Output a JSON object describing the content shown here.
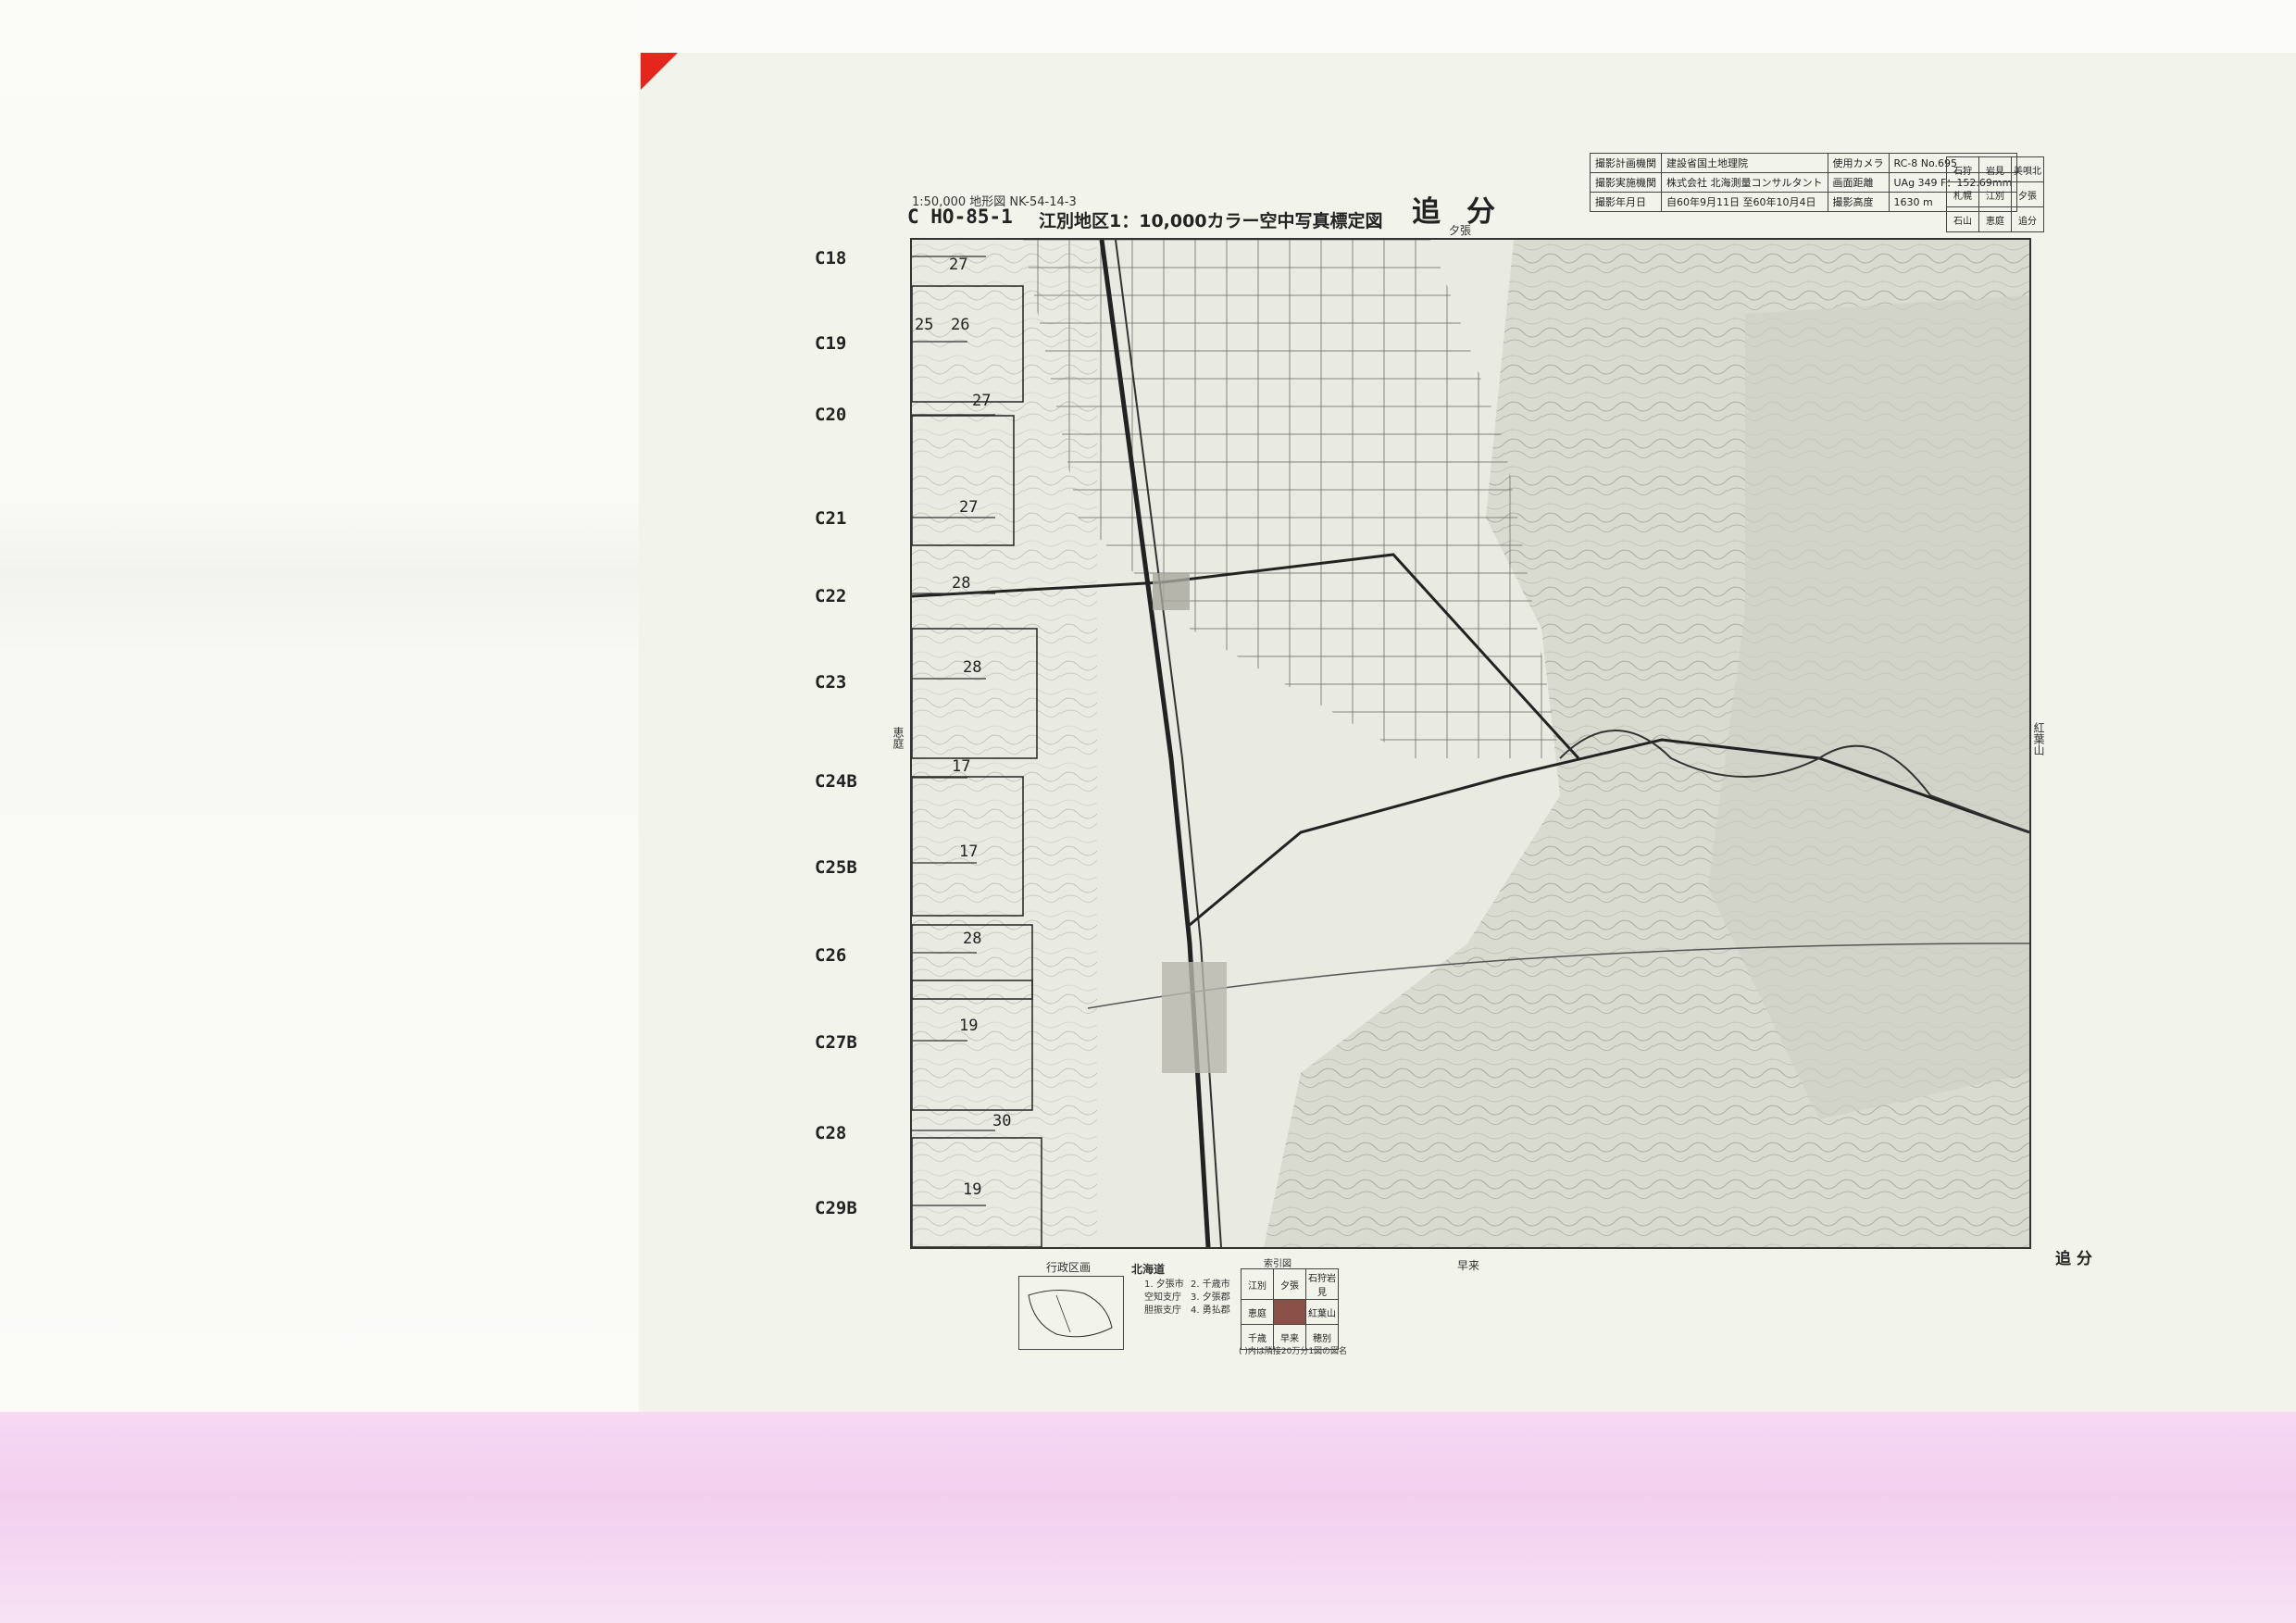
{
  "colors": {
    "sheet": "#f2f3ea",
    "corner_mark": "#e5261c",
    "pink_band": "#f2cfee",
    "ink": "#222222"
  },
  "header": {
    "map_ref": "1:50,000 地形図  NK-54-14-3",
    "sheet_code": "C HO-85-1",
    "subtitle": "江別地区1：10,000カラー空中写真標定図",
    "sheet_name": "追分",
    "bottom_right_name": "追 分"
  },
  "info_table": [
    [
      "撮影計画機関",
      "建設省国土地理院",
      "使用カメラ",
      "RC-8 No.695"
    ],
    [
      "撮影実施機関",
      "株式会社 北海測量コンサルタント",
      "画面距離",
      "UAg 349 F：152.69mm"
    ],
    [
      "撮影年月日",
      "自60年9月11日 至60年10月4日",
      "撮影高度",
      "1630 m"
    ]
  ],
  "index_table": [
    [
      "石狩",
      "岩見",
      "美唄北"
    ],
    [
      "札幌",
      "江別",
      "夕張"
    ],
    [
      "石山",
      "恵庭",
      "追分"
    ]
  ],
  "row_labels": [
    "C18",
    "C19",
    "C20",
    "C21",
    "C22",
    "C23",
    "C24B",
    "C25B",
    "C26",
    "C27B",
    "C28",
    "C29B"
  ],
  "frame_numbers": [
    {
      "label": "27"
    },
    {
      "label": "25"
    },
    {
      "label": "26"
    },
    {
      "label": "27"
    },
    {
      "label": "27"
    },
    {
      "label": "28"
    },
    {
      "label": "28"
    },
    {
      "label": "17"
    },
    {
      "label": "17"
    },
    {
      "label": "28"
    },
    {
      "label": "19"
    },
    {
      "label": "30"
    },
    {
      "label": "19"
    }
  ],
  "map_labels": {
    "top_place": "夕張",
    "bottom_place": "早来",
    "right_place": "紅葉山",
    "left_place": "恵庭"
  },
  "legend": {
    "admin_title": "行政区画",
    "region": "北海道",
    "items": [
      "1. 夕張市",
      "2. 千歳市",
      "空知支庁",
      "3. 夕張郡",
      "胆振支庁",
      "4. 勇払郡"
    ],
    "index_title": "索引図",
    "index_cells": [
      "江別",
      "夕張",
      "石狩岩見",
      "恵庭",
      "",
      "紅葉山",
      "千歳",
      "早来",
      "穂別"
    ],
    "note": "( )内は隣接20万分1図の図名"
  }
}
